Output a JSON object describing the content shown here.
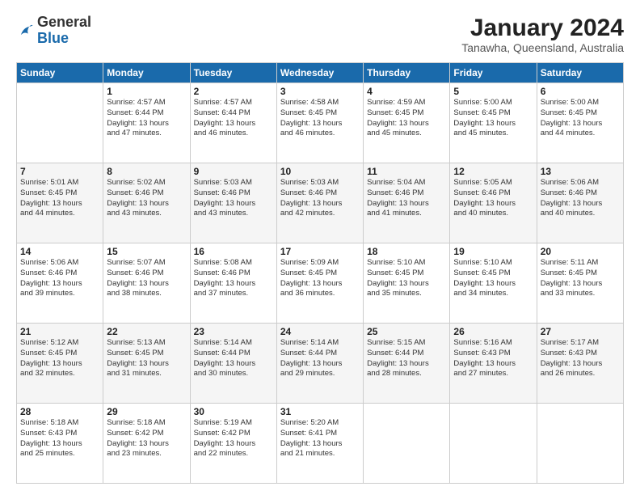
{
  "header": {
    "logo_general": "General",
    "logo_blue": "Blue",
    "month_title": "January 2024",
    "location": "Tanawha, Queensland, Australia"
  },
  "days_of_week": [
    "Sunday",
    "Monday",
    "Tuesday",
    "Wednesday",
    "Thursday",
    "Friday",
    "Saturday"
  ],
  "weeks": [
    [
      {
        "day": "",
        "info": ""
      },
      {
        "day": "1",
        "info": "Sunrise: 4:57 AM\nSunset: 6:44 PM\nDaylight: 13 hours\nand 47 minutes."
      },
      {
        "day": "2",
        "info": "Sunrise: 4:57 AM\nSunset: 6:44 PM\nDaylight: 13 hours\nand 46 minutes."
      },
      {
        "day": "3",
        "info": "Sunrise: 4:58 AM\nSunset: 6:45 PM\nDaylight: 13 hours\nand 46 minutes."
      },
      {
        "day": "4",
        "info": "Sunrise: 4:59 AM\nSunset: 6:45 PM\nDaylight: 13 hours\nand 45 minutes."
      },
      {
        "day": "5",
        "info": "Sunrise: 5:00 AM\nSunset: 6:45 PM\nDaylight: 13 hours\nand 45 minutes."
      },
      {
        "day": "6",
        "info": "Sunrise: 5:00 AM\nSunset: 6:45 PM\nDaylight: 13 hours\nand 44 minutes."
      }
    ],
    [
      {
        "day": "7",
        "info": "Sunrise: 5:01 AM\nSunset: 6:45 PM\nDaylight: 13 hours\nand 44 minutes."
      },
      {
        "day": "8",
        "info": "Sunrise: 5:02 AM\nSunset: 6:46 PM\nDaylight: 13 hours\nand 43 minutes."
      },
      {
        "day": "9",
        "info": "Sunrise: 5:03 AM\nSunset: 6:46 PM\nDaylight: 13 hours\nand 43 minutes."
      },
      {
        "day": "10",
        "info": "Sunrise: 5:03 AM\nSunset: 6:46 PM\nDaylight: 13 hours\nand 42 minutes."
      },
      {
        "day": "11",
        "info": "Sunrise: 5:04 AM\nSunset: 6:46 PM\nDaylight: 13 hours\nand 41 minutes."
      },
      {
        "day": "12",
        "info": "Sunrise: 5:05 AM\nSunset: 6:46 PM\nDaylight: 13 hours\nand 40 minutes."
      },
      {
        "day": "13",
        "info": "Sunrise: 5:06 AM\nSunset: 6:46 PM\nDaylight: 13 hours\nand 40 minutes."
      }
    ],
    [
      {
        "day": "14",
        "info": "Sunrise: 5:06 AM\nSunset: 6:46 PM\nDaylight: 13 hours\nand 39 minutes."
      },
      {
        "day": "15",
        "info": "Sunrise: 5:07 AM\nSunset: 6:46 PM\nDaylight: 13 hours\nand 38 minutes."
      },
      {
        "day": "16",
        "info": "Sunrise: 5:08 AM\nSunset: 6:46 PM\nDaylight: 13 hours\nand 37 minutes."
      },
      {
        "day": "17",
        "info": "Sunrise: 5:09 AM\nSunset: 6:45 PM\nDaylight: 13 hours\nand 36 minutes."
      },
      {
        "day": "18",
        "info": "Sunrise: 5:10 AM\nSunset: 6:45 PM\nDaylight: 13 hours\nand 35 minutes."
      },
      {
        "day": "19",
        "info": "Sunrise: 5:10 AM\nSunset: 6:45 PM\nDaylight: 13 hours\nand 34 minutes."
      },
      {
        "day": "20",
        "info": "Sunrise: 5:11 AM\nSunset: 6:45 PM\nDaylight: 13 hours\nand 33 minutes."
      }
    ],
    [
      {
        "day": "21",
        "info": "Sunrise: 5:12 AM\nSunset: 6:45 PM\nDaylight: 13 hours\nand 32 minutes."
      },
      {
        "day": "22",
        "info": "Sunrise: 5:13 AM\nSunset: 6:45 PM\nDaylight: 13 hours\nand 31 minutes."
      },
      {
        "day": "23",
        "info": "Sunrise: 5:14 AM\nSunset: 6:44 PM\nDaylight: 13 hours\nand 30 minutes."
      },
      {
        "day": "24",
        "info": "Sunrise: 5:14 AM\nSunset: 6:44 PM\nDaylight: 13 hours\nand 29 minutes."
      },
      {
        "day": "25",
        "info": "Sunrise: 5:15 AM\nSunset: 6:44 PM\nDaylight: 13 hours\nand 28 minutes."
      },
      {
        "day": "26",
        "info": "Sunrise: 5:16 AM\nSunset: 6:43 PM\nDaylight: 13 hours\nand 27 minutes."
      },
      {
        "day": "27",
        "info": "Sunrise: 5:17 AM\nSunset: 6:43 PM\nDaylight: 13 hours\nand 26 minutes."
      }
    ],
    [
      {
        "day": "28",
        "info": "Sunrise: 5:18 AM\nSunset: 6:43 PM\nDaylight: 13 hours\nand 25 minutes."
      },
      {
        "day": "29",
        "info": "Sunrise: 5:18 AM\nSunset: 6:42 PM\nDaylight: 13 hours\nand 23 minutes."
      },
      {
        "day": "30",
        "info": "Sunrise: 5:19 AM\nSunset: 6:42 PM\nDaylight: 13 hours\nand 22 minutes."
      },
      {
        "day": "31",
        "info": "Sunrise: 5:20 AM\nSunset: 6:41 PM\nDaylight: 13 hours\nand 21 minutes."
      },
      {
        "day": "",
        "info": ""
      },
      {
        "day": "",
        "info": ""
      },
      {
        "day": "",
        "info": ""
      }
    ]
  ]
}
